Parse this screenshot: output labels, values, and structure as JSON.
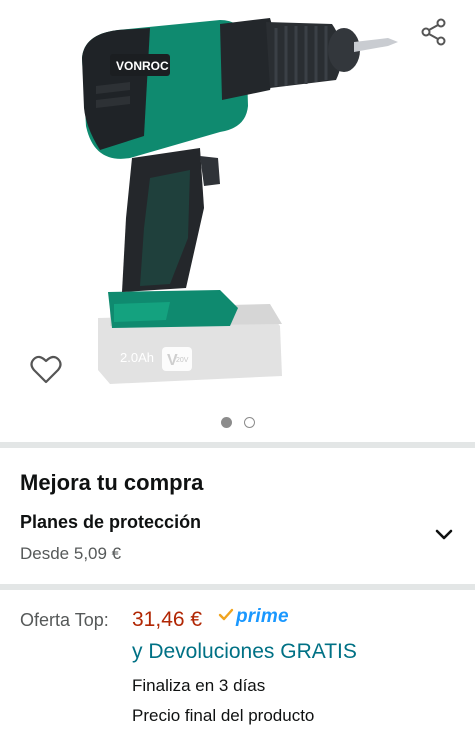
{
  "gallery": {
    "image_alt": "Taladro atornillador VONROC",
    "brand_on_tool": "VONROC",
    "battery_label": "2.0Ah",
    "battery_voltage": "20V",
    "battery_badge": "V",
    "dots": [
      true,
      false
    ],
    "icons": {
      "share": "share-icon",
      "wishlist": "heart-icon"
    }
  },
  "upgrade": {
    "title": "Mejora tu compra",
    "protection": {
      "title": "Planes de protección",
      "price": "Desde 5,09 €"
    }
  },
  "offer": {
    "label": "Oferta Top:",
    "price": "31,46 €",
    "prime": "prime",
    "returns": "y Devoluciones GRATIS",
    "ends": "Finaliza en 3 días",
    "final_price_note": "Precio final del producto"
  },
  "colors": {
    "price": "#b12704",
    "link": "#007185",
    "prime": "#1a98ff",
    "tool_green": "#0f8a6f"
  }
}
